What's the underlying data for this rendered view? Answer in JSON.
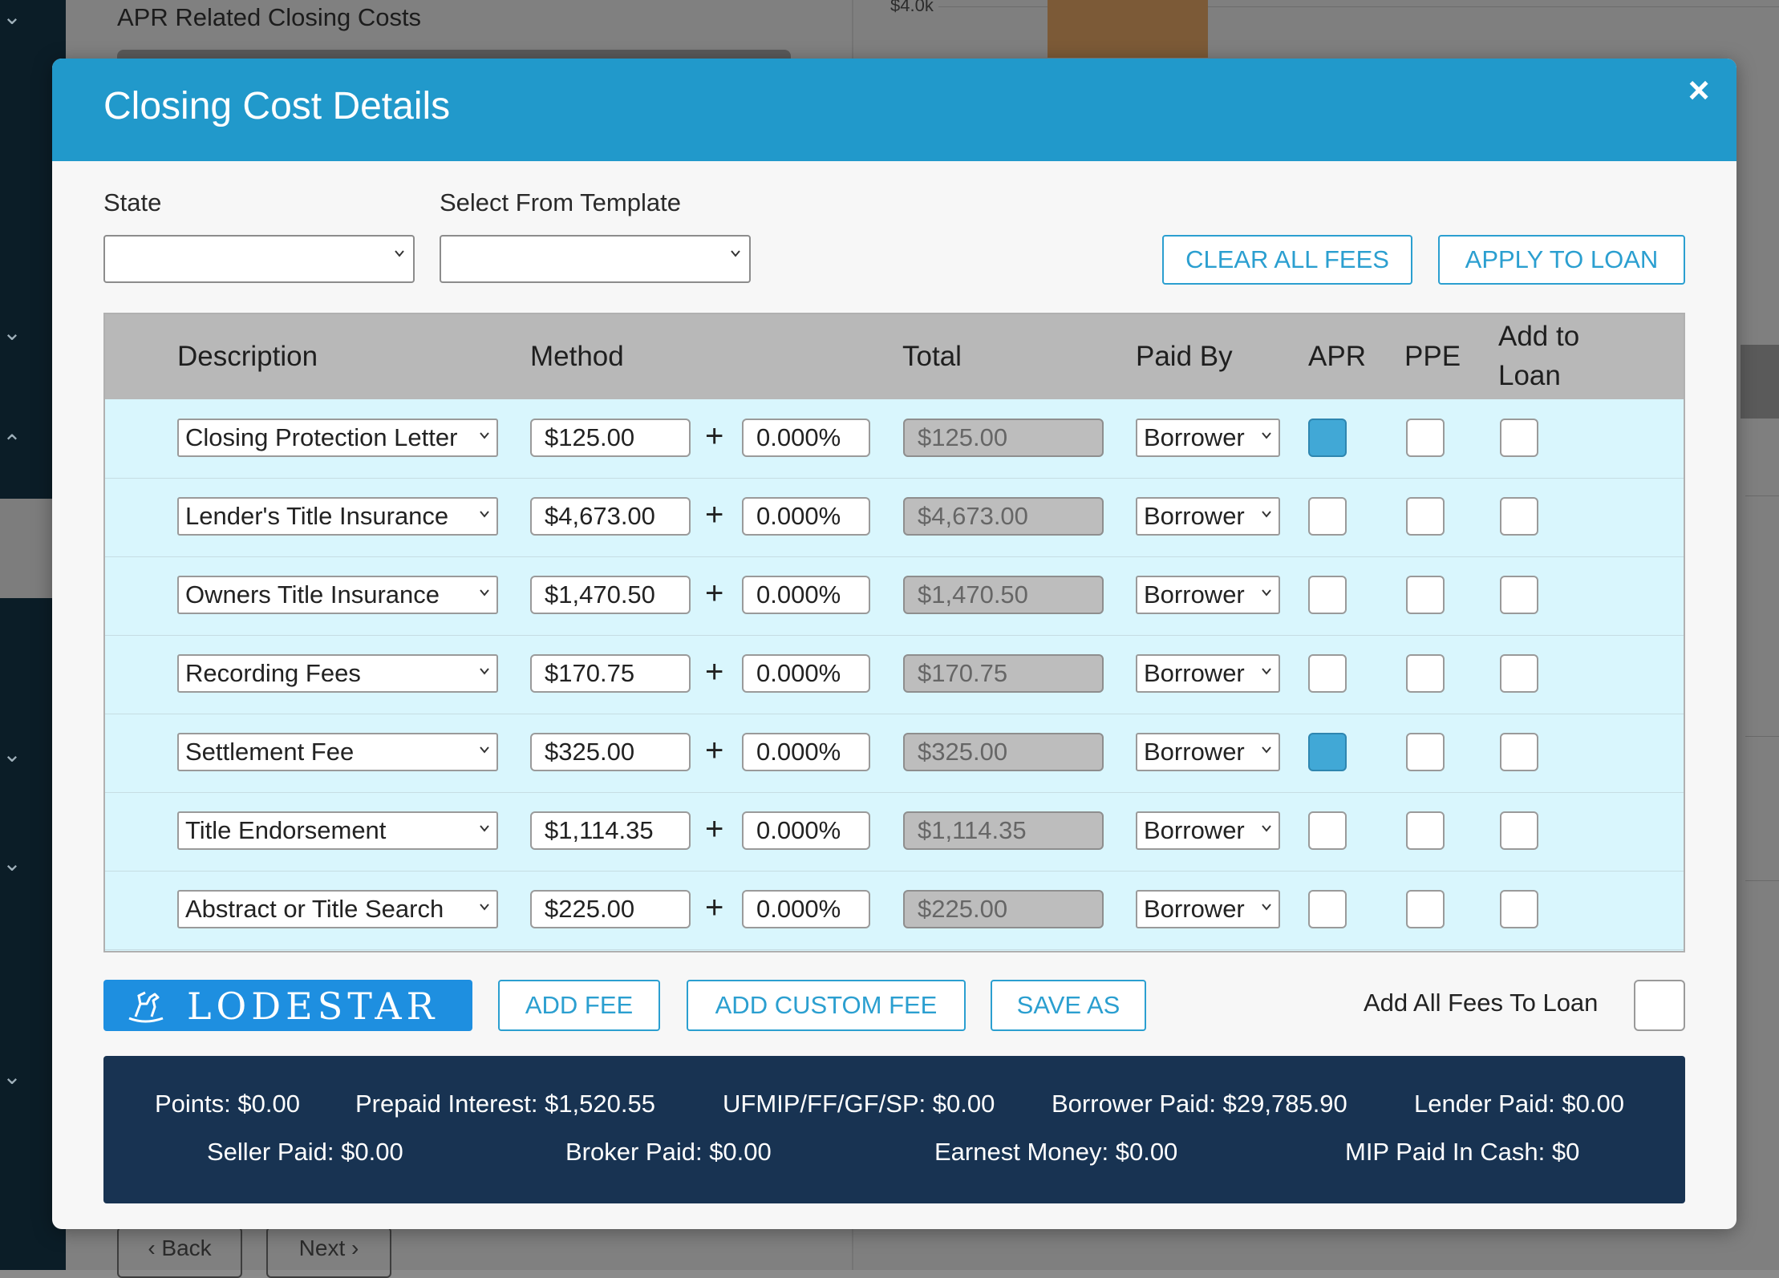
{
  "background": {
    "section_title": "APR Related Closing Costs",
    "axis_label": "$4.0k",
    "back_button": "‹ Back",
    "next_button": "Next ›"
  },
  "modal": {
    "title": "Closing Cost Details",
    "close_symbol": "×"
  },
  "filters": {
    "state_label": "State",
    "state_value": "",
    "template_label": "Select From Template",
    "template_value": ""
  },
  "actions": {
    "clear_all_fees": "CLEAR ALL FEES",
    "apply_to_loan": "APPLY TO LOAN"
  },
  "table": {
    "headers": {
      "description": "Description",
      "method": "Method",
      "total": "Total",
      "paid_by": "Paid By",
      "apr": "APR",
      "ppe": "PPE",
      "add_to_loan_1": "Add to",
      "add_to_loan_2": "Loan"
    },
    "rows": [
      {
        "description": "Closing Protection Letter",
        "amount": "$125.00",
        "percent": "0.000%",
        "total": "$125.00",
        "paid_by": "Borrower",
        "apr": true,
        "ppe": false,
        "add_to_loan": false
      },
      {
        "description": "Lender's Title Insurance",
        "amount": "$4,673.00",
        "percent": "0.000%",
        "total": "$4,673.00",
        "paid_by": "Borrower",
        "apr": false,
        "ppe": false,
        "add_to_loan": false
      },
      {
        "description": "Owners Title Insurance",
        "amount": "$1,470.50",
        "percent": "0.000%",
        "total": "$1,470.50",
        "paid_by": "Borrower",
        "apr": false,
        "ppe": false,
        "add_to_loan": false
      },
      {
        "description": "Recording Fees",
        "amount": "$170.75",
        "percent": "0.000%",
        "total": "$170.75",
        "paid_by": "Borrower",
        "apr": false,
        "ppe": false,
        "add_to_loan": false
      },
      {
        "description": "Settlement Fee",
        "amount": "$325.00",
        "percent": "0.000%",
        "total": "$325.00",
        "paid_by": "Borrower",
        "apr": true,
        "ppe": false,
        "add_to_loan": false
      },
      {
        "description": "Title Endorsement",
        "amount": "$1,114.35",
        "percent": "0.000%",
        "total": "$1,114.35",
        "paid_by": "Borrower",
        "apr": false,
        "ppe": false,
        "add_to_loan": false
      },
      {
        "description": "Abstract or Title Search",
        "amount": "$225.00",
        "percent": "0.000%",
        "total": "$225.00",
        "paid_by": "Borrower",
        "apr": false,
        "ppe": false,
        "add_to_loan": false
      }
    ],
    "plus_symbol": "+"
  },
  "footer": {
    "logo_text": "LODESTAR",
    "add_fee": "ADD FEE",
    "add_custom_fee": "ADD CUSTOM FEE",
    "save_as": "SAVE AS",
    "add_all_fees_label": "Add All Fees To Loan",
    "add_all_fees_checked": false
  },
  "summary": {
    "points": "Points: $0.00",
    "prepaid_interest": "Prepaid Interest: $1,520.55",
    "ufmip": "UFMIP/FF/GF/SP: $0.00",
    "borrower_paid": "Borrower Paid: $29,785.90",
    "lender_paid": "Lender Paid: $0.00",
    "seller_paid": "Seller Paid: $0.00",
    "broker_paid": "Broker Paid: $0.00",
    "earnest_money": "Earnest Money: $0.00",
    "mip_paid_in_cash": "MIP Paid In Cash: $0"
  },
  "colors": {
    "header_blue": "#2199cb",
    "accent": "#2b9fd0",
    "checked": "#41a8d6",
    "summary_bg": "#183352"
  }
}
